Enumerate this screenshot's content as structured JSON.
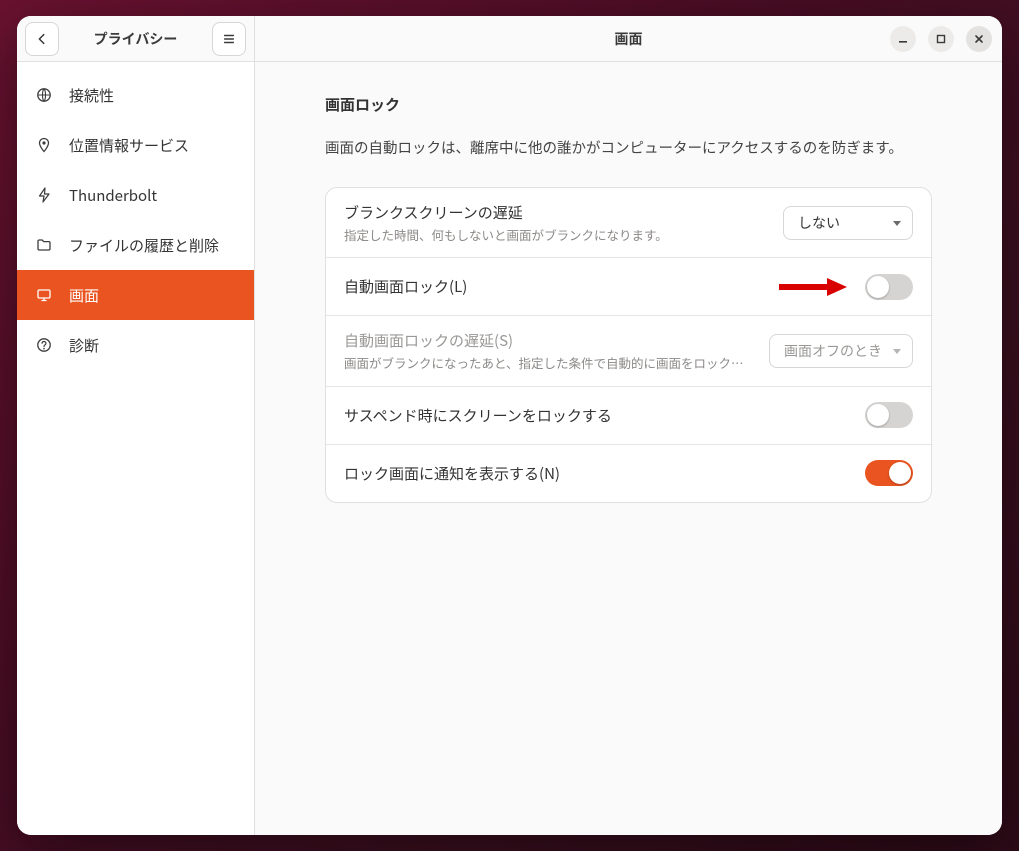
{
  "header": {
    "sidebar_title": "プライバシー",
    "panel_title": "画面"
  },
  "sidebar": {
    "items": [
      {
        "icon": "globe",
        "label": "接続性",
        "active": false
      },
      {
        "icon": "pin",
        "label": "位置情報サービス",
        "active": false
      },
      {
        "icon": "bolt",
        "label": "Thunderbolt",
        "active": false
      },
      {
        "icon": "folder",
        "label": "ファイルの履歴と削除",
        "active": false
      },
      {
        "icon": "monitor",
        "label": "画面",
        "active": true
      },
      {
        "icon": "help",
        "label": "診断",
        "active": false
      }
    ]
  },
  "section": {
    "title": "画面ロック",
    "description": "画面の自動ロックは、離席中に他の誰かがコンピューターにアクセスするのを防ぎます。"
  },
  "rows": {
    "blank_delay": {
      "title": "ブランクスクリーンの遅延",
      "desc": "指定した時間、何もしないと画面がブランクになります。",
      "value": "しない"
    },
    "auto_lock": {
      "title": "自動画面ロック(L)",
      "on": false
    },
    "auto_lock_delay": {
      "title": "自動画面ロックの遅延(S)",
      "desc": "画面がブランクになったあと、指定した条件で自動的に画面をロック…",
      "value": "画面オフのとき",
      "enabled": false
    },
    "lock_on_suspend": {
      "title": "サスペンド時にスクリーンをロックする",
      "on": false
    },
    "show_notifications": {
      "title": "ロック画面に通知を表示する(N)",
      "on": true
    }
  },
  "colors": {
    "accent": "#e95420"
  }
}
